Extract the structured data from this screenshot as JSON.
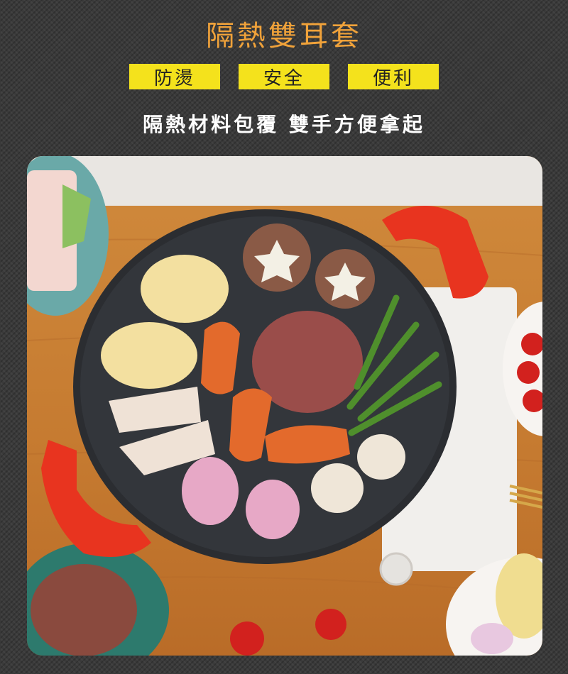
{
  "header": {
    "title": "隔熱雙耳套",
    "tags": [
      "防燙",
      "安全",
      "便利"
    ],
    "subtitle": "隔熱材料包覆 雙手方便拿起"
  },
  "colors": {
    "title": "#f0a23a",
    "tag_bg": "#f4e21c",
    "handle": "#e8341f",
    "pan": "#2b2d31"
  },
  "photo": {
    "alt": "grill pan with food"
  }
}
